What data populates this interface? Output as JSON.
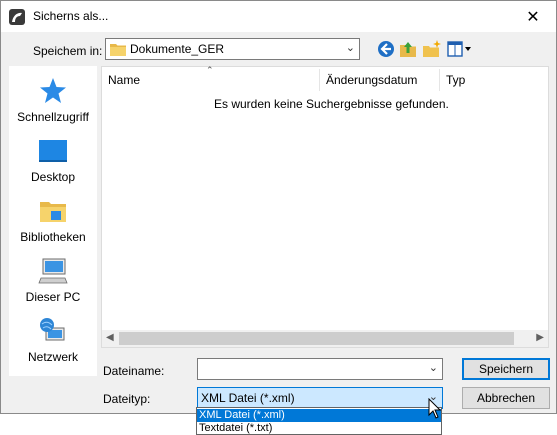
{
  "window": {
    "title": "Sicherns als...",
    "close_glyph": "✕"
  },
  "toolbar": {
    "look_in_label": "Speichem in:",
    "folder": "Dokumente_GER",
    "icons": [
      "back-icon",
      "up-folder-icon",
      "new-folder-icon",
      "view-menu-icon"
    ]
  },
  "places": [
    {
      "label": "Schnellzugriff",
      "icon": "star-icon"
    },
    {
      "label": "Desktop",
      "icon": "desktop-icon"
    },
    {
      "label": "Bibliotheken",
      "icon": "libraries-icon"
    },
    {
      "label": "Dieser PC",
      "icon": "computer-icon"
    },
    {
      "label": "Netzwerk",
      "icon": "network-icon"
    }
  ],
  "filelist": {
    "columns": [
      "Name",
      "Änderungsdatum",
      "Typ"
    ],
    "empty_message": "Es wurden keine Suchergebnisse gefunden."
  },
  "form": {
    "filename_label": "Dateiname:",
    "filename_value": "",
    "filetype_label": "Dateityp:",
    "filetype_selected": "XML Datei (*.xml)",
    "filetype_options": [
      "XML Datei (*.xml)",
      "Textdatei  (*.txt)"
    ]
  },
  "buttons": {
    "save": "Speichern",
    "cancel": "Abbrechen"
  },
  "colors": {
    "accent": "#0078d7",
    "selection_bg": "#cce8ff"
  }
}
